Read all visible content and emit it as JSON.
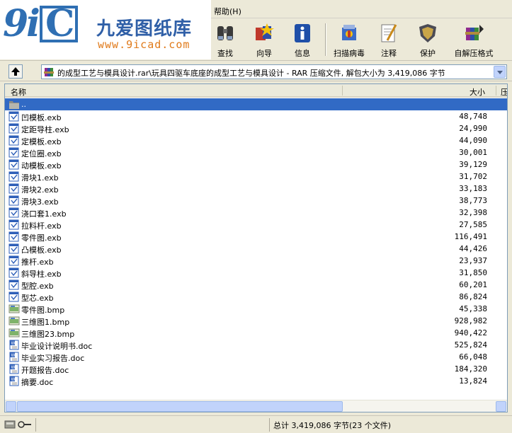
{
  "menu": {
    "help_label": "帮助(H)"
  },
  "logo": {
    "brand_cn": "九爱图纸库",
    "url": "www.9icad.com"
  },
  "toolbar": {
    "buttons": [
      {
        "label": "查找",
        "icon": "binoculars-icon"
      },
      {
        "label": "向导",
        "icon": "wizard-icon"
      },
      {
        "label": "信息",
        "icon": "info-icon"
      },
      {
        "label": "扫描病毒",
        "icon": "virus-scan-icon"
      },
      {
        "label": "注释",
        "icon": "comment-icon"
      },
      {
        "label": "保护",
        "icon": "shield-icon"
      },
      {
        "label": "自解压格式",
        "icon": "sfx-icon"
      }
    ]
  },
  "address": {
    "path": "的成型工艺与模具设计.rar\\玩具四驱车底座的成型工艺与模具设计 - RAR 压缩文件, 解包大小为 3,419,086 字节"
  },
  "columns": {
    "name": "名称",
    "size": "大小",
    "packed": "压"
  },
  "files": [
    {
      "name": "..",
      "size": "",
      "type": "folder"
    },
    {
      "name": "凹模板.exb",
      "size": "48,748",
      "type": "exb"
    },
    {
      "name": "定距导柱.exb",
      "size": "24,990",
      "type": "exb"
    },
    {
      "name": "定模板.exb",
      "size": "44,090",
      "type": "exb"
    },
    {
      "name": "定位圈.exb",
      "size": "30,001",
      "type": "exb"
    },
    {
      "name": "动模板.exb",
      "size": "39,129",
      "type": "exb"
    },
    {
      "name": "滑块1.exb",
      "size": "31,702",
      "type": "exb"
    },
    {
      "name": "滑块2.exb",
      "size": "33,183",
      "type": "exb"
    },
    {
      "name": "滑块3.exb",
      "size": "38,773",
      "type": "exb"
    },
    {
      "name": "浇口套1.exb",
      "size": "32,398",
      "type": "exb"
    },
    {
      "name": "拉料杆.exb",
      "size": "27,585",
      "type": "exb"
    },
    {
      "name": "零件图.exb",
      "size": "116,491",
      "type": "exb"
    },
    {
      "name": "凸模板.exb",
      "size": "44,426",
      "type": "exb"
    },
    {
      "name": "推杆.exb",
      "size": "23,937",
      "type": "exb"
    },
    {
      "name": "斜导柱.exb",
      "size": "31,850",
      "type": "exb"
    },
    {
      "name": "型腔.exb",
      "size": "60,201",
      "type": "exb"
    },
    {
      "name": "型芯.exb",
      "size": "86,824",
      "type": "exb"
    },
    {
      "name": "零件图.bmp",
      "size": "45,338",
      "type": "bmp"
    },
    {
      "name": "三维图1.bmp",
      "size": "928,982",
      "type": "bmp"
    },
    {
      "name": "三维图23.bmp",
      "size": "940,422",
      "type": "bmp"
    },
    {
      "name": "毕业设计说明书.doc",
      "size": "525,824",
      "type": "doc"
    },
    {
      "name": "毕业实习报告.doc",
      "size": "66,048",
      "type": "doc"
    },
    {
      "name": "开题报告.doc",
      "size": "184,320",
      "type": "doc"
    },
    {
      "name": "摘要.doc",
      "size": "13,824",
      "type": "doc"
    }
  ],
  "status": {
    "summary": "总计 3,419,086 字节(23 个文件)"
  },
  "colors": {
    "selection": "#316ac5",
    "chrome": "#ece9d8",
    "logo_blue": "#2f6fb3",
    "logo_orange": "#e07a1a"
  }
}
